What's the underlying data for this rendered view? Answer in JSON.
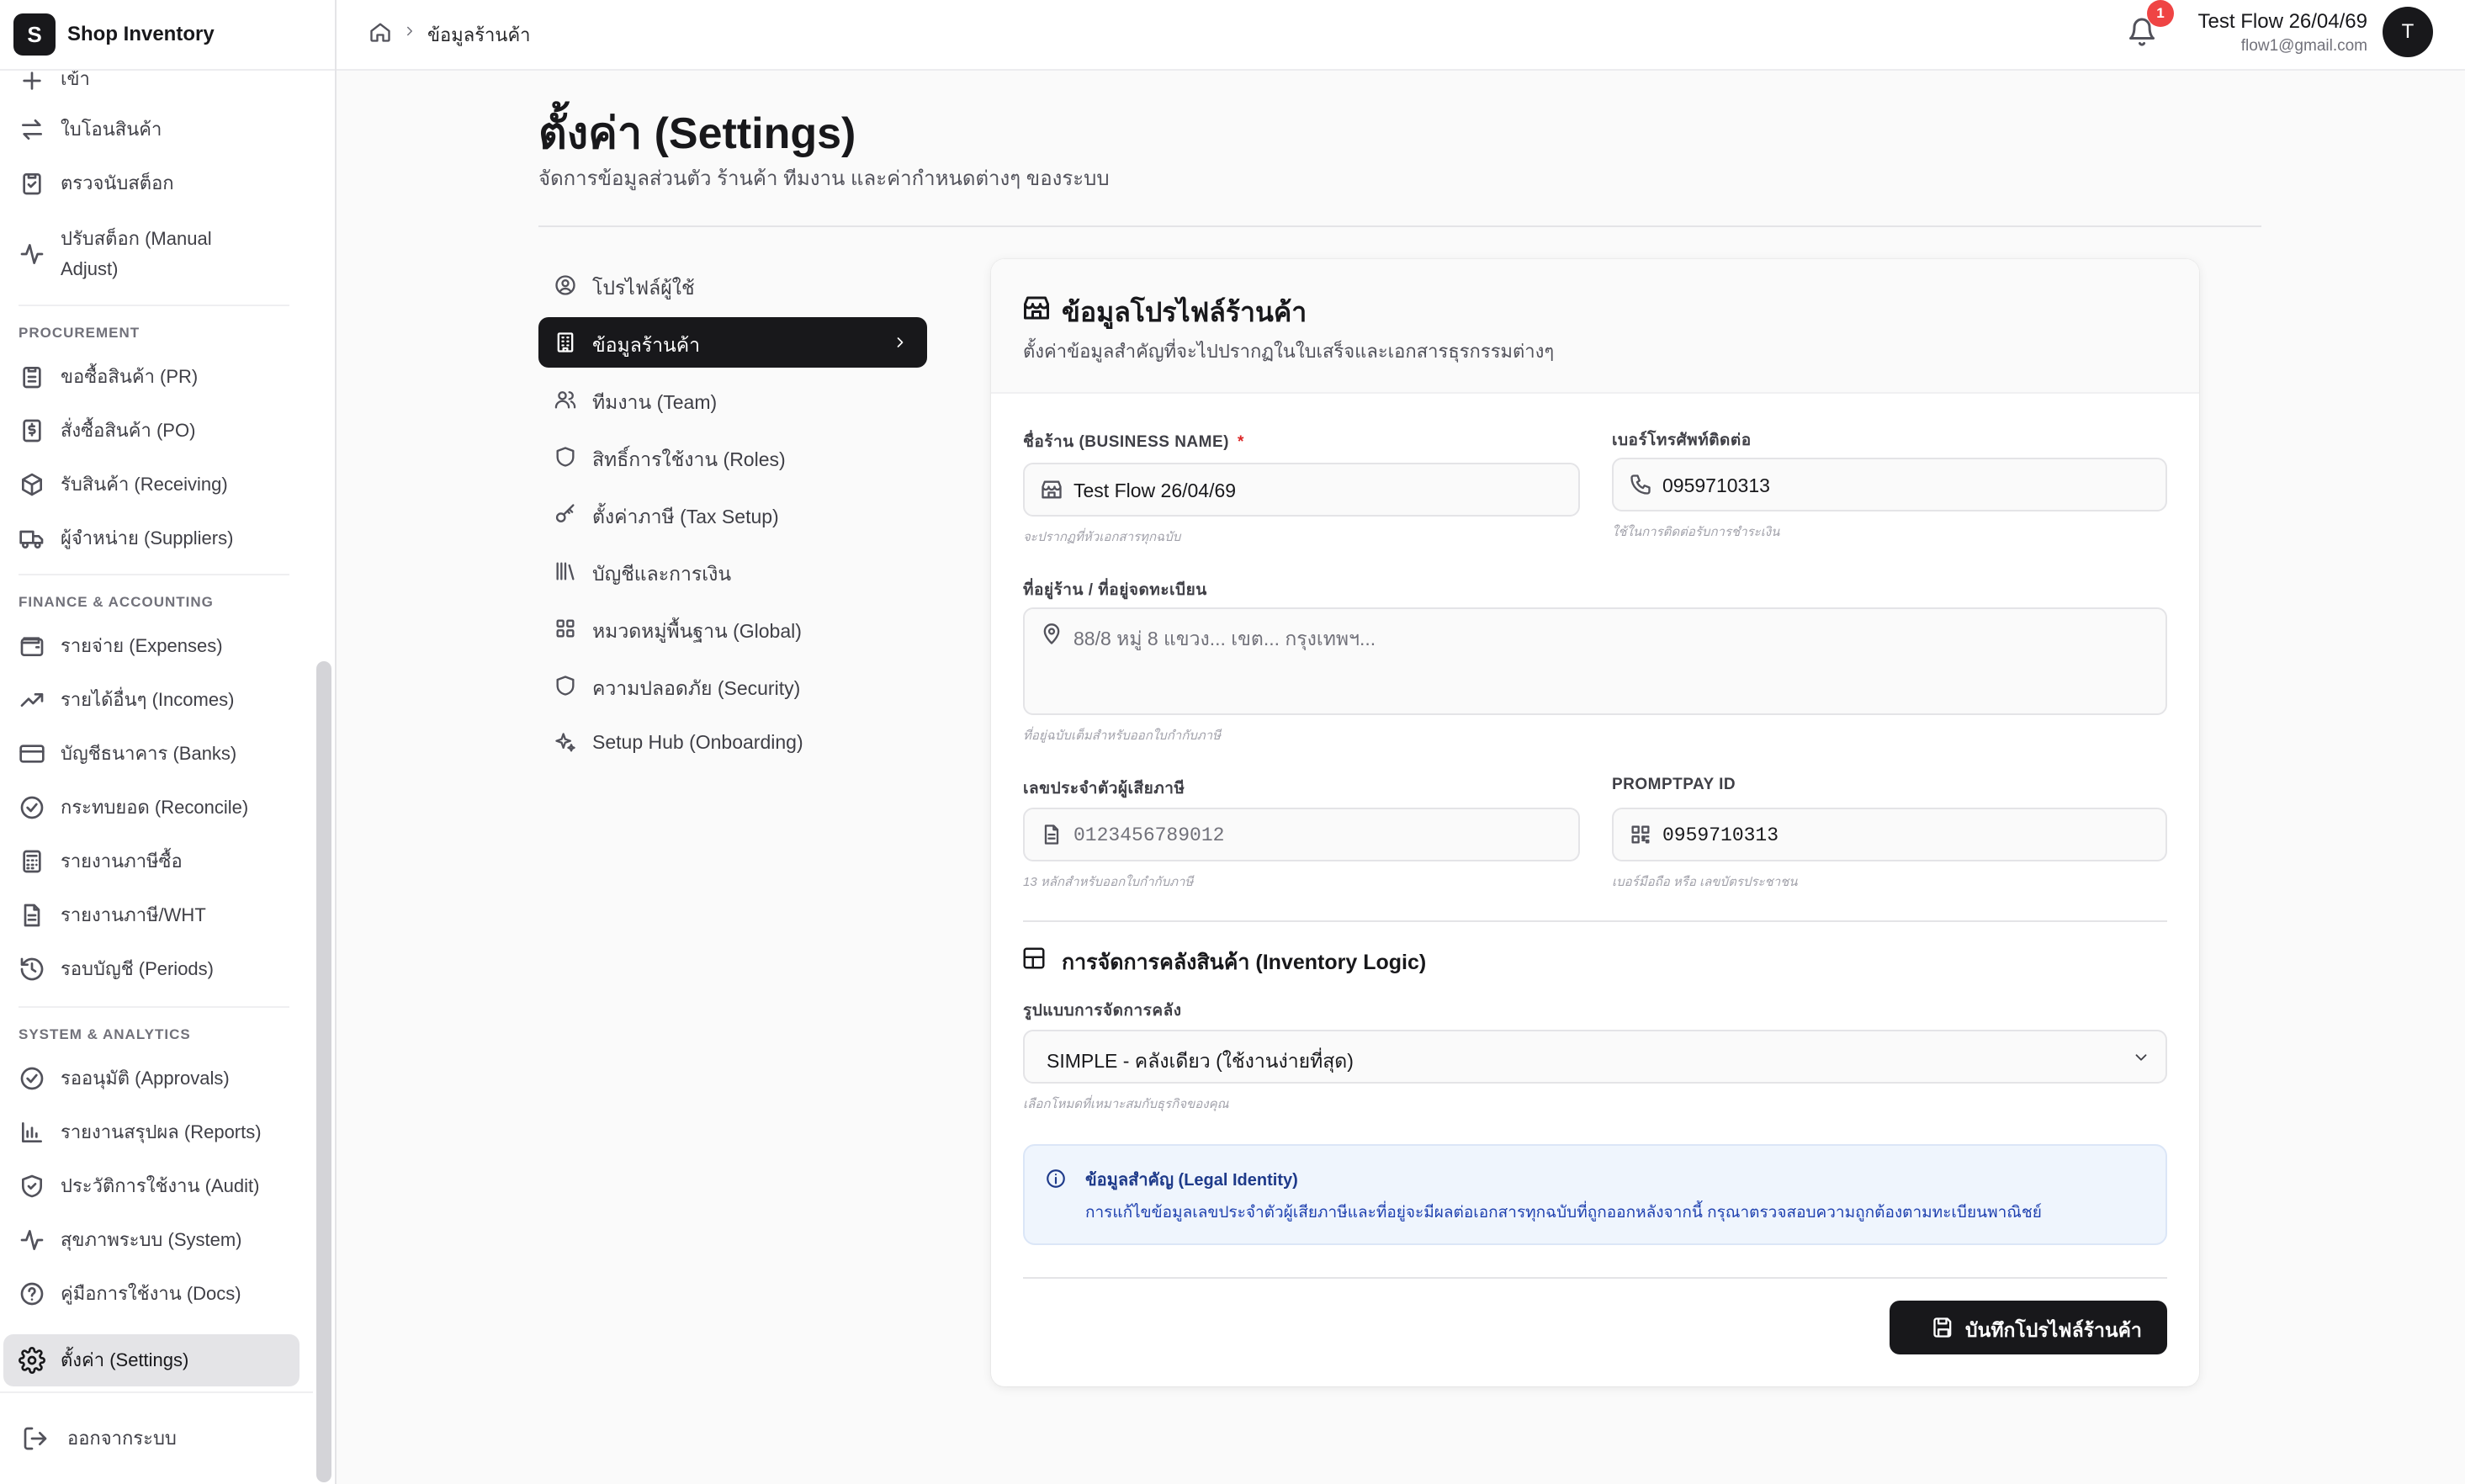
{
  "brand": {
    "logo_letter": "S",
    "name": "Shop Inventory"
  },
  "sidebar": {
    "cut_label": "เข้า",
    "items_top": [
      {
        "label": "ใบโอนสินค้า"
      },
      {
        "label": "ตรวจนับสต็อก"
      },
      {
        "label": "ปรับสต็อก (Manual Adjust)"
      }
    ],
    "procurement": {
      "title": "PROCUREMENT",
      "items": [
        {
          "label": "ขอซื้อสินค้า (PR)"
        },
        {
          "label": "สั่งซื้อสินค้า (PO)"
        },
        {
          "label": "รับสินค้า (Receiving)"
        },
        {
          "label": "ผู้จำหน่าย (Suppliers)"
        }
      ]
    },
    "finance": {
      "title": "FINANCE & ACCOUNTING",
      "items": [
        {
          "label": "รายจ่าย (Expenses)"
        },
        {
          "label": "รายได้อื่นๆ (Incomes)"
        },
        {
          "label": "บัญชีธนาคาร (Banks)"
        },
        {
          "label": "กระทบยอด (Reconcile)"
        },
        {
          "label": "รายงานภาษีซื้อ"
        },
        {
          "label": "รายงานภาษี/WHT"
        },
        {
          "label": "รอบบัญชี (Periods)"
        }
      ]
    },
    "system": {
      "title": "SYSTEM & ANALYTICS",
      "items": [
        {
          "label": "รออนุมัติ (Approvals)"
        },
        {
          "label": "รายงานสรุปผล (Reports)"
        },
        {
          "label": "ประวัติการใช้งาน (Audit)"
        },
        {
          "label": "สุขภาพระบบ (System)"
        },
        {
          "label": "คู่มือการใช้งาน (Docs)"
        }
      ]
    },
    "active": {
      "label": "ตั้งค่า (Settings)"
    },
    "logout": {
      "label": "ออกจากระบบ"
    }
  },
  "topbar": {
    "breadcrumb_current": "ข้อมูลร้านค้า",
    "notification_count": "1",
    "user_name": "Test Flow 26/04/69",
    "user_email": "flow1@gmail.com",
    "avatar_letter": "T"
  },
  "page": {
    "title": "ตั้งค่า (Settings)",
    "subtitle": "จัดการข้อมูลส่วนตัว ร้านค้า ทีมงาน และค่ากำหนดต่างๆ ของระบบ"
  },
  "settings_nav": [
    {
      "label": "โปรไฟล์ผู้ใช้",
      "icon": "user-circle-icon"
    },
    {
      "label": "ข้อมูลร้านค้า",
      "icon": "building-icon",
      "active": true
    },
    {
      "label": "ทีมงาน (Team)",
      "icon": "users-icon"
    },
    {
      "label": "สิทธิ์การใช้งาน (Roles)",
      "icon": "shield-icon"
    },
    {
      "label": "ตั้งค่าภาษี (Tax Setup)",
      "icon": "key-icon"
    },
    {
      "label": "บัญชีและการเงิน",
      "icon": "library-icon"
    },
    {
      "label": "หมวดหมู่พื้นฐาน (Global)",
      "icon": "grid-icon"
    },
    {
      "label": "ความปลอดภัย (Security)",
      "icon": "shield-icon"
    },
    {
      "label": "Setup Hub (Onboarding)",
      "icon": "sparkles-icon"
    }
  ],
  "card": {
    "title": "ข้อมูลโปรไฟล์ร้านค้า",
    "description": "ตั้งค่าข้อมูลสำคัญที่จะไปปรากฏในใบเสร็จและเอกสารธุรกรรมต่างๆ",
    "business_name": {
      "label": "ชื่อร้าน (BUSINESS NAME)",
      "required_mark": "*",
      "value": "Test Flow 26/04/69",
      "hint": "จะปรากฏที่หัวเอกสารทุกฉบับ"
    },
    "phone": {
      "label": "เบอร์โทรศัพท์ติดต่อ",
      "value": "0959710313",
      "hint": "ใช้ในการติดต่อรับการชำระเงิน"
    },
    "address": {
      "label": "ที่อยู่ร้าน / ที่อยู่จดทะเบียน",
      "placeholder": "88/8 หมู่ 8 แขวง... เขต... กรุงเทพฯ...",
      "hint": "ที่อยู่ฉบับเต็มสำหรับออกใบกำกับภาษี"
    },
    "tax_id": {
      "label": "เลขประจำตัวผู้เสียภาษี",
      "placeholder": "0123456789012",
      "hint": "13 หลักสำหรับออกใบกำกับภาษี"
    },
    "promptpay": {
      "label": "PROMPTPAY ID",
      "value": "0959710313",
      "hint": "เบอร์มือถือ หรือ เลขบัตรประชาชน"
    },
    "inventory": {
      "title": "การจัดการคลังสินค้า (Inventory Logic)",
      "mode_label": "รูปแบบการจัดการคลัง",
      "mode_value": "SIMPLE - คลังเดียว (ใช้งานง่ายที่สุด)",
      "mode_hint": "เลือกโหมดที่เหมาะสมกับธุรกิจของคุณ"
    },
    "alert": {
      "title": "ข้อมูลสำคัญ (Legal Identity)",
      "body": "การแก้ไขข้อมูลเลขประจำตัวผู้เสียภาษีและที่อยู่จะมีผลต่อเอกสารทุกฉบับที่ถูกออกหลังจากนี้ กรุณาตรวจสอบความถูกต้องตามทะเบียนพาณิชย์"
    },
    "save_label": "บันทึกโปรไฟล์ร้านค้า"
  },
  "colors": {
    "primary": "#18181b",
    "danger": "#ef4444",
    "info_bg": "#eff5fd",
    "info_text": "#1e3a8a"
  }
}
